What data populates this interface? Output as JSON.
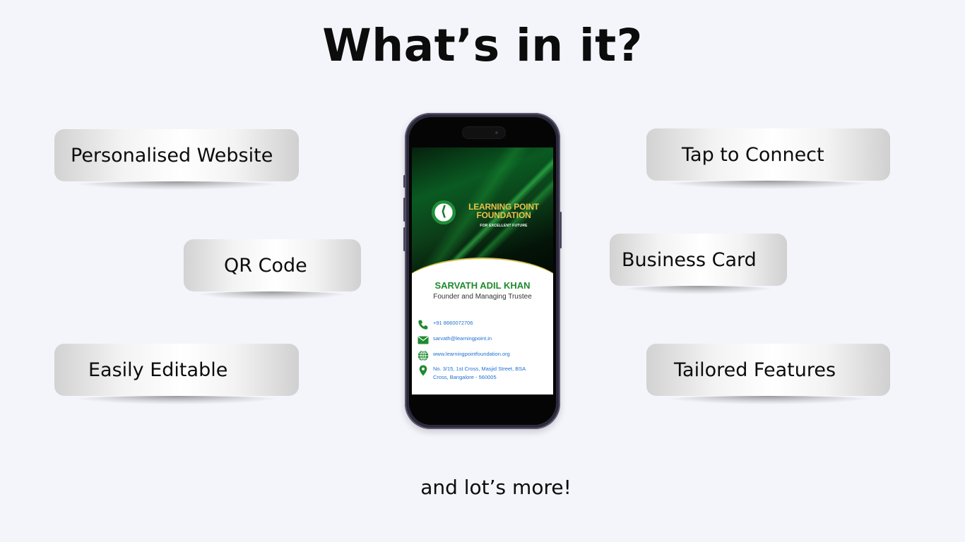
{
  "heading": "What’s in it?",
  "features": {
    "personalised_website": "Personalised Website",
    "tap_to_connect": "Tap to Connect",
    "qr_code": "QR Code",
    "business_card": "Business Card",
    "easily_editable": "Easily Editable",
    "tailored_features": "Tailored Features"
  },
  "footer": "and lot’s more!",
  "card": {
    "org_name_line1": "LEARNING POINT",
    "org_name_line2": "FOUNDATION",
    "org_tagline": "FOR EXCELLENT FUTURE",
    "person_name": "SARVATH ADIL KHAN",
    "person_role": "Founder and Managing Trustee",
    "phone": "+91 8660072706",
    "email": "sarvath@learningpoint.in",
    "website": "www.learningpointfoundation.org",
    "address_line1": "No. 3/15, 1st Cross, Masjid Street, BSA",
    "address_line2": "Cross, Bangalore - 560005"
  },
  "icons": {
    "phone": "phone-icon",
    "email": "envelope-icon",
    "website": "globe-icon",
    "address": "location-pin-icon"
  },
  "colors": {
    "background": "#f4f5fa",
    "card_green": "#1f8a2e",
    "card_gold": "#e8c24b",
    "link_blue": "#1f6fcf"
  }
}
